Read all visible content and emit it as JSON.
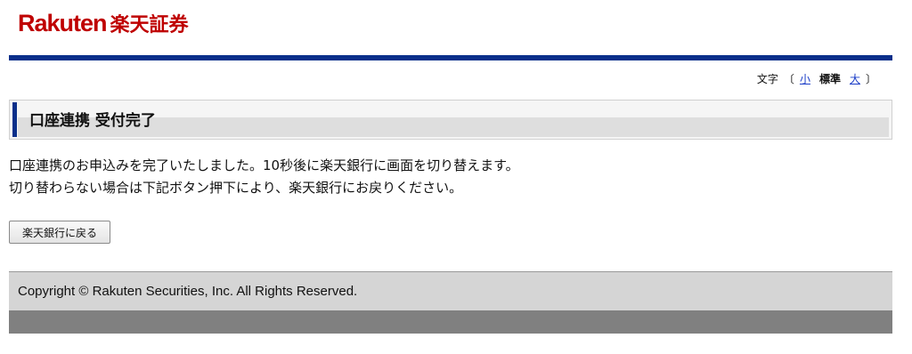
{
  "brand": {
    "logo_en": "Rakuten",
    "logo_ja": "楽天証券",
    "logo_color": "#bf0000",
    "bar_color": "#0a2f8a"
  },
  "font_size": {
    "label": "文字",
    "bracket_open": "〔",
    "small": "小",
    "standard": "標準",
    "large": "大",
    "bracket_close": "〕"
  },
  "page": {
    "title": "口座連携 受付完了",
    "line1": "口座連携のお申込みを完了いたしました。10秒後に楽天銀行に画面を切り替えます。",
    "line2": "切り替わらない場合は下記ボタン押下により、楽天銀行にお戻りください。",
    "back_button": "楽天銀行に戻る"
  },
  "footer": {
    "copyright": "Copyright © Rakuten Securities, Inc. All Rights Reserved."
  }
}
